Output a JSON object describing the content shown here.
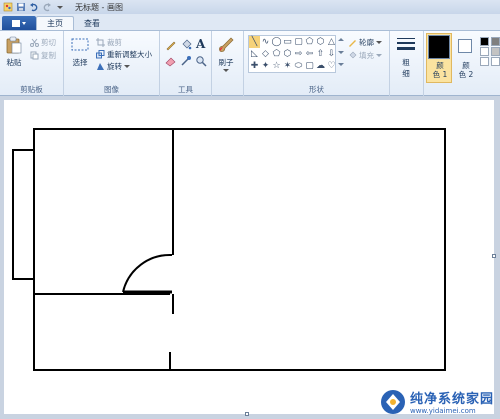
{
  "window": {
    "title": "无标题 - 画图"
  },
  "qat": {
    "items": [
      "save-icon",
      "undo-icon",
      "redo-icon",
      "customize-icon"
    ]
  },
  "tabs": {
    "home": "主页",
    "view": "查看"
  },
  "clipboard": {
    "paste": "粘贴",
    "cut": "剪切",
    "copy": "复制",
    "label": "剪贴板"
  },
  "image": {
    "select": "选择",
    "crop": "裁剪",
    "resize": "重新调整大小",
    "rotate": "旋转",
    "label": "图像"
  },
  "tools": {
    "label": "工具"
  },
  "brushes": {
    "label": "刷子"
  },
  "shapes": {
    "glyphs": [
      "╲",
      "∿",
      "◯",
      "▭",
      "▢",
      "⬠",
      "⬡",
      "△",
      "◺",
      "◇",
      "⬠",
      "⬡",
      "⇨",
      "⇦",
      "⇧",
      "⇩",
      "✚",
      "✦",
      "☆",
      "✶",
      "⬭",
      "▢",
      "☁",
      "♡"
    ],
    "outline": "轮廓",
    "fill": "填充",
    "label": "形状"
  },
  "size": {
    "line1": "粗",
    "line2": "细"
  },
  "colors": {
    "color1_line1": "颜",
    "color1_line2": "色 1",
    "color2_line1": "颜",
    "color2_line2": "色 2",
    "color1_value": "#000000",
    "color2_value": "#ffffff"
  },
  "watermark": {
    "name": "纯净系统家园",
    "url": "www.yidaimei.com"
  }
}
